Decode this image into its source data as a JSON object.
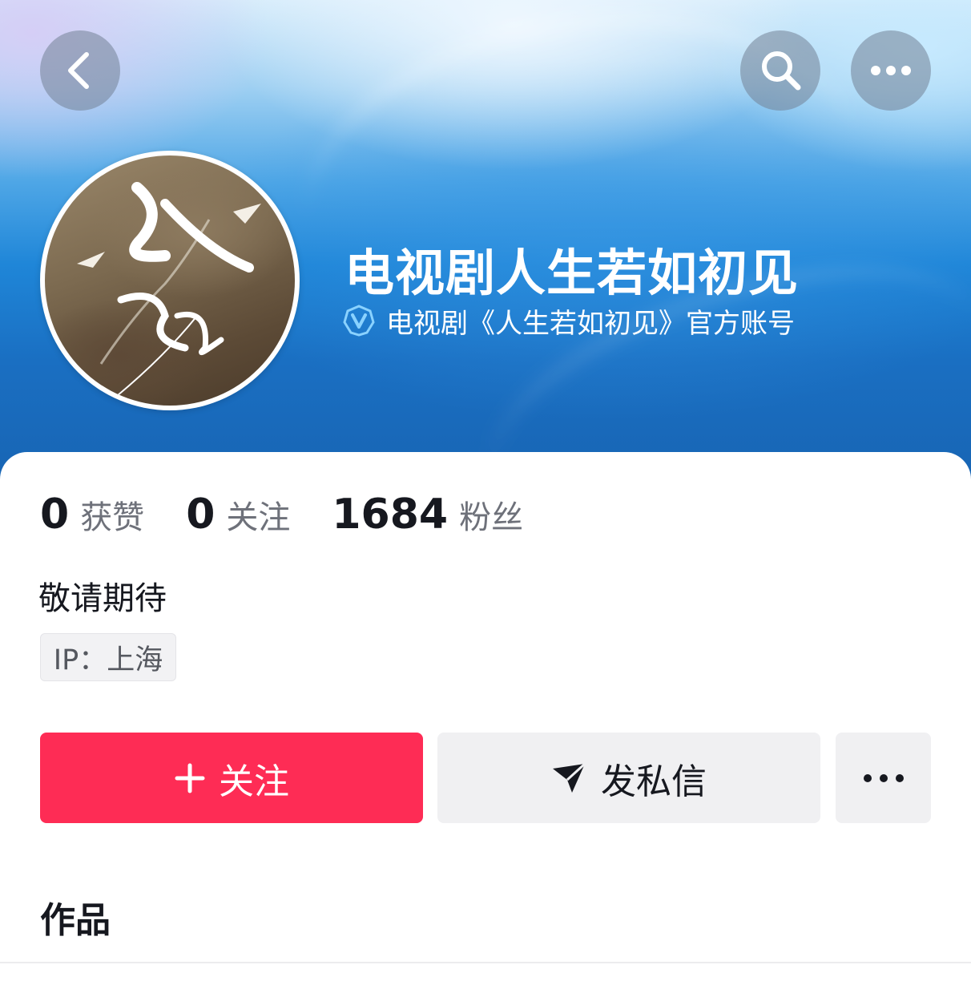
{
  "header": {
    "back_icon": "chevron-left-icon",
    "search_icon": "search-icon",
    "more_icon": "more-dots-icon"
  },
  "profile": {
    "avatar_icon": "avatar",
    "name": "电视剧人生若如初见",
    "verified_icon": "verified-v-icon",
    "verified_text": "电视剧《人生若如初见》官方账号"
  },
  "stats": [
    {
      "value": "0",
      "label": "获赞"
    },
    {
      "value": "0",
      "label": "关注"
    },
    {
      "value": "1684",
      "label": "粉丝"
    }
  ],
  "bio": "敬请期待",
  "ip_tag": "IP：上海",
  "actions": {
    "follow_label": "关注",
    "follow_icon": "plus-icon",
    "message_label": "发私信",
    "message_icon": "send-icon",
    "more_icon": "more-dots-icon"
  },
  "tabs": {
    "works": "作品"
  },
  "colors": {
    "accent": "#fe2c55",
    "banner_blue": "#1f86d8",
    "verified_blue": "#6fc3f7"
  }
}
